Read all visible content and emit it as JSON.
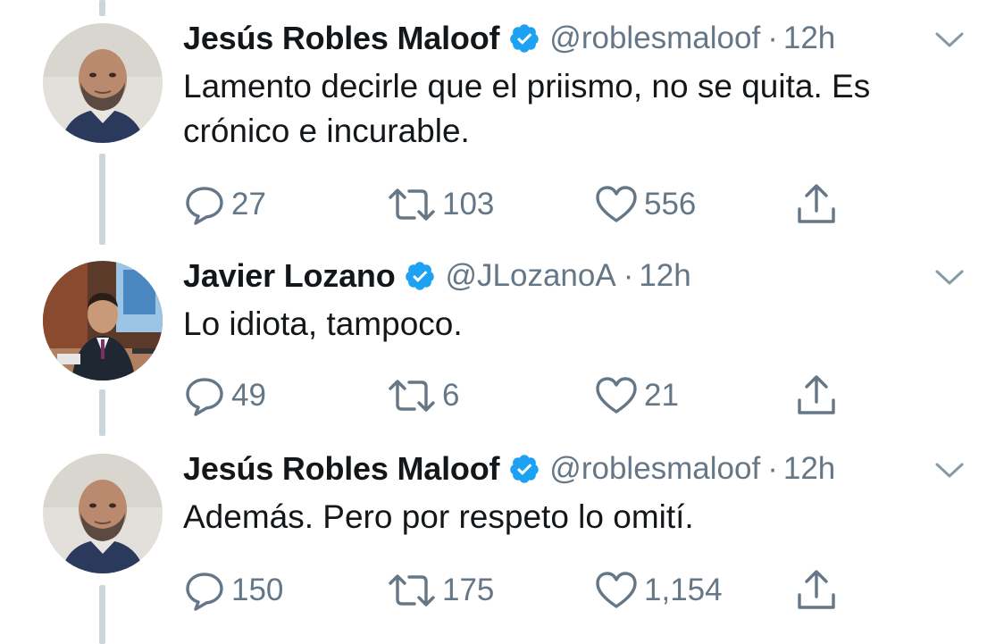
{
  "tweets": [
    {
      "display_name": "Jesús Robles Maloof",
      "handle": "@roblesmaloof",
      "separator": "·",
      "timestamp": "12h",
      "text": "Lamento decirle que el priismo, no se quita. Es crónico e incurable.",
      "replies": "27",
      "retweets": "103",
      "likes": "556",
      "avatar_icon": "bald-man-avatar"
    },
    {
      "display_name": "Javier Lozano",
      "handle": "@JLozanoA",
      "separator": "·",
      "timestamp": "12h",
      "text": "Lo idiota, tampoco.",
      "replies": "49",
      "retweets": "6",
      "likes": "21",
      "avatar_icon": "man-in-suit-at-desk-avatar"
    },
    {
      "display_name": "Jesús Robles Maloof",
      "handle": "@roblesmaloof",
      "separator": "·",
      "timestamp": "12h",
      "text": "Además. Pero por respeto lo omití.",
      "replies": "150",
      "retweets": "175",
      "likes": "1,154",
      "avatar_icon": "bald-man-avatar"
    }
  ],
  "icons": {
    "verified": "verified-badge-icon",
    "menu": "chevron-down-icon",
    "reply": "reply-bubble-icon",
    "retweet": "retweet-arrows-icon",
    "like": "heart-icon",
    "share": "share-upload-icon"
  },
  "colors": {
    "text_primary": "#14171a",
    "text_secondary": "#657786",
    "verified_blue": "#1da1f2",
    "thread_line": "#ccd6dd"
  }
}
